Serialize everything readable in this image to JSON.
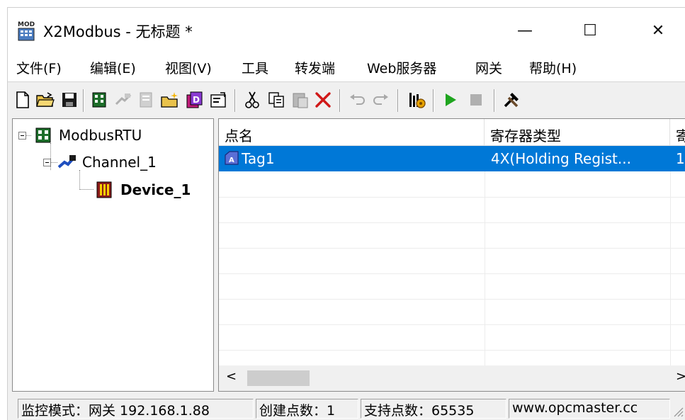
{
  "window": {
    "title": "X2Modbus - 无标题 *",
    "icon_label": "MOD",
    "minimize": "—",
    "maximize": "☐",
    "close": "✕"
  },
  "menu": [
    "文件(F)",
    "编辑(E)",
    "视图(V)",
    "工具",
    "转发端",
    "Web服务器",
    "网关",
    "帮助(H)"
  ],
  "toolbar": {
    "icons": [
      "new-file-icon",
      "open-folder-icon",
      "save-icon",
      "add-channel-icon",
      "channel-disabled-icon",
      "device-disabled-icon",
      "new-device-icon",
      "database-icon",
      "properties-icon",
      "cut-icon",
      "copy-icon",
      "paste-icon",
      "delete-icon",
      "undo-icon",
      "redo-icon",
      "monitor-icon",
      "run-icon",
      "stop-icon",
      "tools-icon"
    ]
  },
  "tree": {
    "root": "ModbusRTU",
    "channel": "Channel_1",
    "device": "Device_1"
  },
  "list": {
    "columns": [
      "点名",
      "寄存器类型",
      "寄"
    ],
    "rows": [
      {
        "name": "Tag1",
        "register_type": "4X(Holding Regist...",
        "extra": "1"
      }
    ],
    "scroll_left": "<",
    "scroll_right": ">"
  },
  "status": {
    "mode": "监控模式：网关 192.168.1.88",
    "created": "创建点数：1",
    "supported": "支持点数：65535",
    "site": "www.opcmaster.cc"
  },
  "colors": {
    "selection": "#0078d7",
    "run_green": "#1fa51f",
    "delete_red": "#d01818"
  }
}
